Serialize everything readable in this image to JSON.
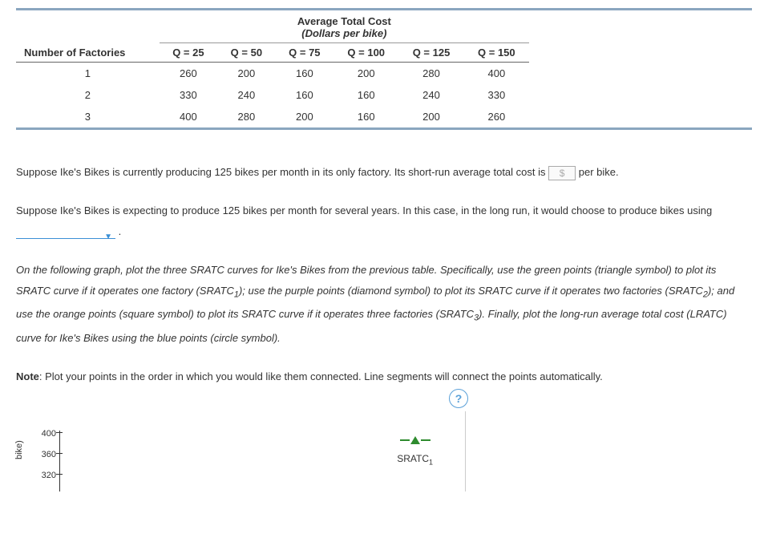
{
  "chart_data": {
    "type": "table",
    "title": "Average Total Cost",
    "subtitle": "(Dollars per bike)",
    "row_header": "Number of Factories",
    "columns": [
      "Q = 25",
      "Q = 50",
      "Q = 75",
      "Q = 100",
      "Q = 125",
      "Q = 150"
    ],
    "rows": [
      {
        "label": "1",
        "values": [
          260,
          200,
          160,
          200,
          280,
          400
        ]
      },
      {
        "label": "2",
        "values": [
          330,
          240,
          160,
          160,
          240,
          330
        ]
      },
      {
        "label": "3",
        "values": [
          400,
          280,
          200,
          160,
          200,
          260
        ]
      }
    ]
  },
  "q1": {
    "pre": "Suppose Ike's Bikes is currently producing 125 bikes per month in its only factory. Its short-run average total cost is ",
    "currency": "$",
    "post": " per bike."
  },
  "q2": {
    "pre": "Suppose Ike's Bikes is expecting to produce 125 bikes per month for several years. In this case, in the long run, it would choose to produce bikes using ",
    "period": "."
  },
  "instr": {
    "s1": "On the following graph, plot the three SRATC curves for Ike's Bikes from the previous table. Specifically, use the green points (triangle symbol) to plot its SRATC curve if it operates one factory (",
    "sr1": "SRATC",
    "sr1sub": "1",
    "s2": "); use the purple points (diamond symbol) to plot its SRATC curve if it operates two factories (",
    "sr2": "SRATC",
    "sr2sub": "2",
    "s3": "); and use the orange points (square symbol) to plot its SRATC curve if it operates three factories (",
    "sr3": "SRATC",
    "sr3sub": "3",
    "s4": "). Finally, plot the long-run average total cost (LRATC) curve for Ike's Bikes using the blue points (circle symbol)."
  },
  "note": {
    "label": "Note",
    "text": ": Plot your points in the order in which you would like them connected. Line segments will connect the points automatically."
  },
  "graph": {
    "help": "?",
    "ticks": {
      "t400": "400",
      "t360": "360",
      "t320": "320"
    },
    "ylabel": "bike)",
    "legend": {
      "label": "SRATC",
      "sub": "1"
    }
  }
}
